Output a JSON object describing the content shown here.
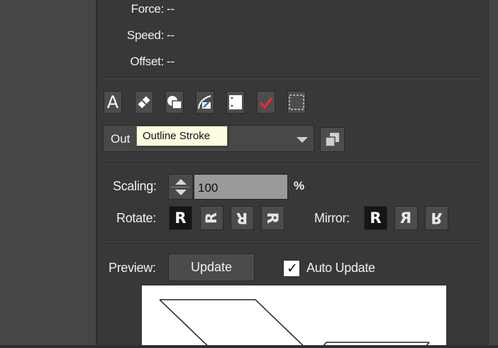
{
  "info": {
    "force_label": "Force:",
    "force_value": "--",
    "speed_label": "Speed:",
    "speed_value": "--",
    "offset_label": "Offset:",
    "offset_value": "--"
  },
  "toolbar": {
    "tools": [
      "text-tool-icon",
      "eraser-icon",
      "shape-union-icon",
      "pen-tool-icon",
      "artboard-icon",
      "checkmark-icon",
      "marquee-select-icon"
    ],
    "tool_glyph_text": "A"
  },
  "operation": {
    "selected_value": "Out",
    "tooltip": "Outline Stroke"
  },
  "scaling": {
    "label": "Scaling:",
    "value": "100",
    "unit": "%"
  },
  "rotate": {
    "label": "Rotate:",
    "glyph": "R"
  },
  "mirror": {
    "label": "Mirror:",
    "glyph": "R"
  },
  "preview": {
    "label": "Preview:",
    "update_button": "Update",
    "auto_update_label": "Auto Update",
    "auto_update_checked": true,
    "check_glyph": "✓"
  },
  "colors": {
    "panel": "#383838",
    "accent_red": "#e0302a",
    "input_bg": "#9a9a9a",
    "tooltip_bg": "#fdfde0"
  }
}
